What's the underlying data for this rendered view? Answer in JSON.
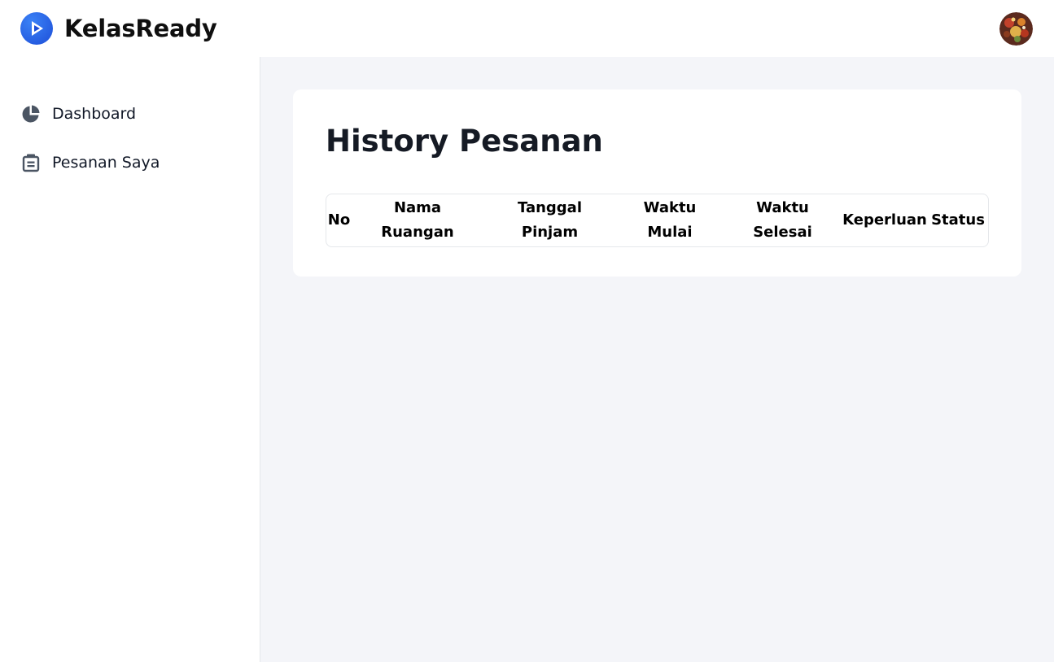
{
  "header": {
    "app_name": "KelasReady",
    "logo_icon": "play-logo-icon",
    "avatar_icon": "user-avatar"
  },
  "sidebar": {
    "items": [
      {
        "label": "Dashboard",
        "icon": "pie-chart-icon"
      },
      {
        "label": "Pesanan Saya",
        "icon": "document-list-icon"
      }
    ]
  },
  "main": {
    "title": "History Pesanan",
    "table": {
      "columns": [
        [
          "No"
        ],
        [
          "Nama",
          "Ruangan"
        ],
        [
          "Tanggal",
          "Pinjam"
        ],
        [
          "Waktu",
          "Mulai"
        ],
        [
          "Waktu",
          "Selesai"
        ],
        [
          "Keperluan"
        ],
        [
          "Status"
        ]
      ],
      "rows": []
    }
  },
  "colors": {
    "main_background": "#f4f5f9",
    "logo_blue": "#1d4ed8",
    "icon_gray": "#4b5563"
  }
}
